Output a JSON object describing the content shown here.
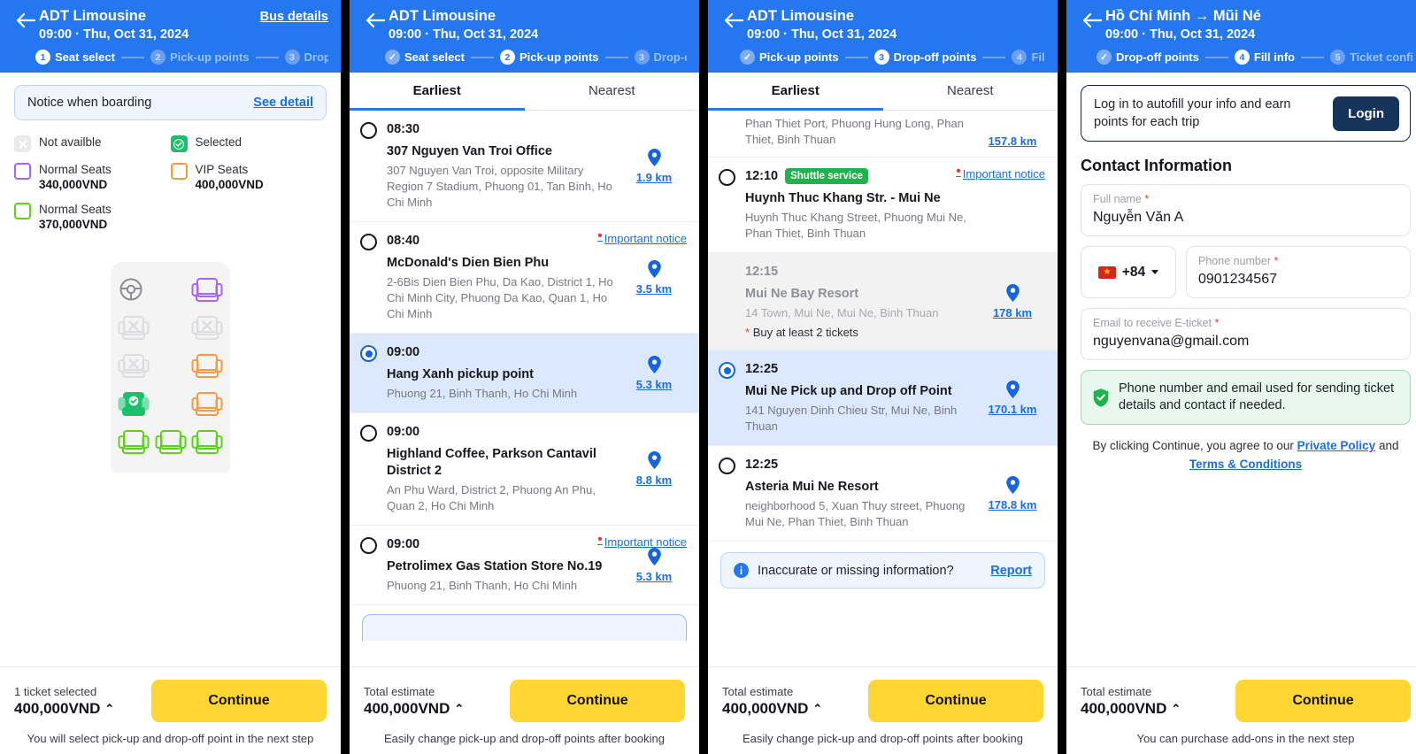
{
  "colors": {
    "header_blue": "#2577F0",
    "accent_yellow": "#FFD633",
    "link_blue": "#1A6FE0",
    "green": "#21B24B",
    "selected_row": "#DCE8FD"
  },
  "panel1": {
    "header": {
      "title": "ADT Limousine",
      "subtitle": "09:00 · Thu, Oct 31, 2024",
      "action_label": "Bus details",
      "back_icon": "arrow-left-icon"
    },
    "steps": [
      {
        "num": "1",
        "label": "Seat select",
        "state": "active"
      },
      {
        "num": "2",
        "label": "Pick-up points",
        "state": "todo"
      },
      {
        "num": "3",
        "label": "Drop-off p",
        "state": "todo"
      }
    ],
    "notice": {
      "text": "Notice when boarding",
      "link": "See detail"
    },
    "legend": [
      {
        "type": "not-available",
        "label": "Not availble",
        "price": ""
      },
      {
        "type": "selected",
        "label": "Selected",
        "price": ""
      },
      {
        "type": "normal-purple",
        "label": "Normal Seats",
        "price": "340,000VND",
        "color": "#A964F7"
      },
      {
        "type": "vip-orange",
        "label": "VIP Seats",
        "price": "400,000VND",
        "color": "#F59A3E"
      },
      {
        "type": "normal-green",
        "label": "Normal Seats",
        "price": "370,000VND",
        "color": "#5CD219"
      }
    ],
    "seatmap": {
      "rows": [
        [
          {
            "kind": "driver"
          },
          {
            "kind": "empty"
          },
          {
            "kind": "seat",
            "color": "#A964F7",
            "state": "available"
          }
        ],
        [
          {
            "kind": "seat",
            "state": "unavailable"
          },
          {
            "kind": "empty"
          },
          {
            "kind": "seat",
            "state": "unavailable"
          }
        ],
        [
          {
            "kind": "seat",
            "state": "unavailable"
          },
          {
            "kind": "empty"
          },
          {
            "kind": "seat",
            "color": "#F59A3E",
            "state": "available"
          }
        ],
        [
          {
            "kind": "seat",
            "color": "#17C26B",
            "state": "selected"
          },
          {
            "kind": "empty"
          },
          {
            "kind": "seat",
            "color": "#F59A3E",
            "state": "available"
          }
        ],
        [
          {
            "kind": "seat",
            "color": "#5CD219",
            "state": "available"
          },
          {
            "kind": "seat",
            "color": "#5CD219",
            "state": "available"
          },
          {
            "kind": "seat",
            "color": "#5CD219",
            "state": "available"
          }
        ]
      ]
    },
    "bottom": {
      "caption": "1 ticket selected",
      "amount": "400,000VND",
      "caret": "⌃",
      "button": "Continue",
      "note": "You will select pick-up and drop-off point in the next step"
    }
  },
  "panel2": {
    "header": {
      "title": "ADT Limousine",
      "subtitle": "09:00 · Thu, Oct 31, 2024",
      "back_icon": "arrow-left-icon"
    },
    "steps": [
      {
        "num": "✓",
        "label": "Seat select",
        "state": "done"
      },
      {
        "num": "2",
        "label": "Pick-up points",
        "state": "active"
      },
      {
        "num": "3",
        "label": "Drop-off",
        "state": "todo"
      }
    ],
    "tabs": [
      {
        "label": "Earliest",
        "active": true
      },
      {
        "label": "Nearest",
        "active": false
      }
    ],
    "points": [
      {
        "time": "08:30",
        "name": "307 Nguyen Van Troi Office",
        "address": "307 Nguyen Van Troi, opposite Military Region 7 Stadium, Phuong 01, Tan Binh, Ho Chi Minh",
        "distance": "1.9 km",
        "selected": false,
        "notice": ""
      },
      {
        "time": "08:40",
        "name": "McDonald's Dien Bien Phu",
        "address": "2-6Bis Dien Bien Phu, Da Kao, District 1, Ho Chi Minh City, Phuong Da Kao, Quan 1, Ho Chi Minh",
        "distance": "3.5 km",
        "selected": false,
        "notice": "Important notice"
      },
      {
        "time": "09:00",
        "name": "Hang Xanh pickup point",
        "address": "Phuong 21, Binh Thanh, Ho Chi Minh",
        "distance": "5.3 km",
        "selected": true,
        "notice": ""
      },
      {
        "time": "09:00",
        "name": "Highland Coffee, Parkson Cantavil District 2",
        "address": "An Phu Ward, District 2, Phuong An Phu, Quan 2, Ho Chi Minh",
        "distance": "8.8 km",
        "selected": false,
        "notice": ""
      },
      {
        "time": "09:00",
        "name": "Petrolimex Gas Station Store No.19",
        "address": "Phuong 21, Binh Thanh, Ho Chi Minh",
        "distance": "5.3 km",
        "selected": false,
        "notice": "Important notice"
      }
    ],
    "bottom": {
      "caption": "Total estimate",
      "amount": "400,000VND",
      "caret": "⌃",
      "button": "Continue",
      "note": "Easily change pick-up and drop-off points after booking"
    }
  },
  "panel3": {
    "header": {
      "title": "ADT Limousine",
      "subtitle": "09:00 · Thu, Oct 31, 2024",
      "back_icon": "arrow-left-icon"
    },
    "steps": [
      {
        "num": "✓",
        "label": "Pick-up points",
        "state": "done"
      },
      {
        "num": "3",
        "label": "Drop-off points",
        "state": "active"
      },
      {
        "num": "4",
        "label": "Fill int",
        "state": "todo"
      }
    ],
    "tabs": [
      {
        "label": "Earliest",
        "active": true
      },
      {
        "label": "Nearest",
        "active": false
      }
    ],
    "scrolled_partial": {
      "address": "Phan Thiet Port, Phuong Hung Long, Phan Thiet, Binh Thuan",
      "distance": "157.8 km"
    },
    "points": [
      {
        "time": "12:10",
        "badge": "Shuttle service",
        "name": "Huynh Thuc Khang Str. - Mui Ne",
        "address": "Huynh Thuc Khang Street, Phuong Mui Ne, Phan Thiet, Binh Thuan",
        "distance": "",
        "selected": false,
        "disabled": false,
        "notice": "Important notice"
      },
      {
        "time": "12:15",
        "badge": "",
        "name": "Mui Ne Bay Resort",
        "address": "14 Town, Mui Ne, Mui Ne, Binh Thuan",
        "warning": "Buy at least 2 tickets",
        "distance": "178 km",
        "selected": false,
        "disabled": true,
        "notice": ""
      },
      {
        "time": "12:25",
        "badge": "",
        "name": "Mui Ne Pick up and Drop off Point",
        "address": "141 Nguyen Dinh Chieu Str, Mui Ne, Binh Thuan",
        "distance": "170.1 km",
        "selected": true,
        "disabled": false,
        "notice": ""
      },
      {
        "time": "12:25",
        "badge": "",
        "name": "Asteria Mui Ne Resort",
        "address": "neighborhood 5, Xuan Thuy street, Phuong Mui Ne, Phan Thiet, Binh Thuan",
        "distance": "178.8 km",
        "selected": false,
        "disabled": false,
        "notice": ""
      }
    ],
    "report": {
      "text": "Inaccurate or missing information?",
      "link": "Report"
    },
    "bottom": {
      "caption": "Total estimate",
      "amount": "400,000VND",
      "caret": "⌃",
      "button": "Continue",
      "note": "Easily change pick-up and drop-off points after booking"
    }
  },
  "panel4": {
    "header": {
      "title": "Hồ Chí Minh → Mũi Né",
      "subtitle": "09:00 · Thu, Oct 31, 2024",
      "back_icon": "arrow-left-icon"
    },
    "steps": [
      {
        "num": "✓",
        "label": "Drop-off points",
        "state": "done"
      },
      {
        "num": "4",
        "label": "Fill info",
        "state": "active"
      },
      {
        "num": "5",
        "label": "Ticket confirr",
        "state": "todo"
      }
    ],
    "login": {
      "text": "Log in to autofill your info and earn points for each trip",
      "button": "Login"
    },
    "section_title": "Contact Information",
    "fields": {
      "full_name": {
        "label": "Full name",
        "required": "*",
        "value": "Nguyễn Văn A"
      },
      "country_code": {
        "value": "+84",
        "flag": "vietnam-flag-icon"
      },
      "phone": {
        "label": "Phone number",
        "required": "*",
        "value": "0901234567"
      },
      "email": {
        "label": "Email to receive E-ticket",
        "required": "*",
        "value": "nguyenvana@gmail.com"
      }
    },
    "green_note": "Phone number and email used for sending ticket details and contact if needed.",
    "terms": {
      "prefix": "By clicking Continue, you agree to our ",
      "link1": "Private Policy",
      "middle": " and ",
      "link2": "Terms & Conditions"
    },
    "bottom": {
      "caption": "Total estimate",
      "amount": "400,000VND",
      "caret": "⌃",
      "button": "Continue",
      "note": "You can purchase add-ons in the next step"
    }
  }
}
